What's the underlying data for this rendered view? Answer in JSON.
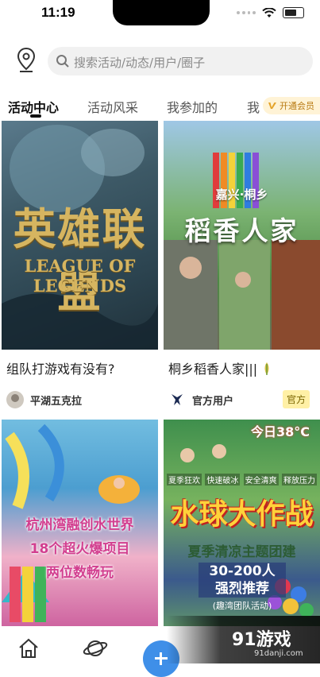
{
  "status": {
    "time": "11:19"
  },
  "search": {
    "placeholder": "搜索活动/动态/用户/圈子"
  },
  "tabs": [
    {
      "label": "活动中心"
    },
    {
      "label": "活动风采"
    },
    {
      "label": "我参加的"
    },
    {
      "label": "我"
    }
  ],
  "vip": {
    "label": "开通会员"
  },
  "cards": [
    {
      "title": "组队打游戏有没有?",
      "author": "平湖五克拉",
      "overlay_big": "英雄联盟",
      "overlay_sub": "LEAGUE OF LEGENDS"
    },
    {
      "title": "桐乡稻香人家|||",
      "author": "官方用户",
      "badge": "官方",
      "overlay_small": "嘉兴·桐乡",
      "overlay_big": "稻香人家"
    },
    {
      "overlay_lines": [
        "杭州湾融创水世界",
        "18个超火爆项目",
        "两位数畅玩"
      ]
    },
    {
      "badge_temp": "今日38°C",
      "tags": [
        "夏季狂欢",
        "快速破冰",
        "安全清爽",
        "释放压力"
      ],
      "overlay_big": "水球大作战",
      "overlay_sub": "夏季清凉主题团建",
      "overlay_count": "30-200人",
      "overlay_rec": "强烈推荐",
      "overlay_desc": "(趣湾团队活动)"
    }
  ],
  "watermark": {
    "brand": "91游戏",
    "url": "91danji.com"
  },
  "colors": {
    "accent": "#3f8fe8",
    "vip_text": "#b87a12",
    "official_bg": "#fff0a6"
  }
}
